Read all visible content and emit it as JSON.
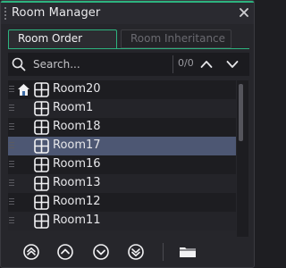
{
  "window": {
    "title": "Room Manager",
    "accent_color": "#2db37f"
  },
  "tabs": [
    {
      "label": "Room Order",
      "active": true
    },
    {
      "label": "Room Inheritance",
      "active": false
    }
  ],
  "search": {
    "placeholder": "Search...",
    "value": "",
    "match_count": "0/0"
  },
  "rooms": [
    {
      "name": "Room20",
      "home": true,
      "selected": false
    },
    {
      "name": "Room1",
      "home": false,
      "selected": false
    },
    {
      "name": "Room18",
      "home": false,
      "selected": false
    },
    {
      "name": "Room17",
      "home": false,
      "selected": true
    },
    {
      "name": "Room16",
      "home": false,
      "selected": false
    },
    {
      "name": "Room13",
      "home": false,
      "selected": false
    },
    {
      "name": "Room12",
      "home": false,
      "selected": false
    },
    {
      "name": "Room11",
      "home": false,
      "selected": false
    }
  ],
  "toolbar": {
    "buttons": [
      "move-to-top-icon",
      "move-up-icon",
      "move-down-icon",
      "move-to-bottom-icon",
      "folder-icon"
    ]
  },
  "colors": {
    "selected_row": "#4d5773",
    "background": "#26262b"
  }
}
